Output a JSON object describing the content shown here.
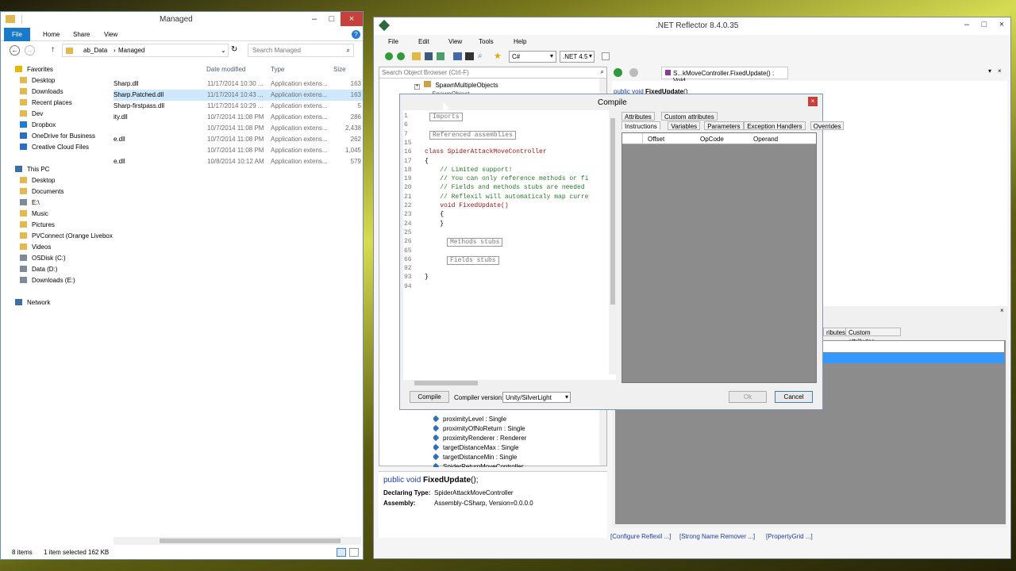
{
  "explorer": {
    "title": "Managed",
    "ribbon": [
      "File",
      "Home",
      "Share",
      "View"
    ],
    "path": [
      "ab_Data",
      "Managed"
    ],
    "search_placeholder": "Search Managed",
    "nav": [
      {
        "label": "Favorites",
        "icon": "star-icon",
        "group": true
      },
      {
        "label": "Desktop",
        "icon": "folder-icon"
      },
      {
        "label": "Downloads",
        "icon": "folder-icon"
      },
      {
        "label": "Recent places",
        "icon": "folder-icon"
      },
      {
        "label": "Dev",
        "icon": "folder-icon"
      },
      {
        "label": "Dropbox",
        "icon": "dropbox-icon"
      },
      {
        "label": "OneDrive for Business",
        "icon": "cloud-icon"
      },
      {
        "label": "Creative Cloud Files",
        "icon": "cloud-icon"
      },
      {
        "label": "",
        "spacer": true
      },
      {
        "label": "This PC",
        "icon": "computer-icon",
        "group": true
      },
      {
        "label": "Desktop",
        "icon": "folder-icon"
      },
      {
        "label": "Documents",
        "icon": "folder-icon"
      },
      {
        "label": "E:\\",
        "icon": "drive-icon"
      },
      {
        "label": "Music",
        "icon": "folder-icon"
      },
      {
        "label": "Pictures",
        "icon": "folder-icon"
      },
      {
        "label": "PVConnect (Orange Livebox",
        "icon": "folder-icon"
      },
      {
        "label": "Videos",
        "icon": "folder-icon"
      },
      {
        "label": "OSDisk (C:)",
        "icon": "drive-icon"
      },
      {
        "label": "Data (D:)",
        "icon": "drive-icon"
      },
      {
        "label": "Downloads (E:)",
        "icon": "drive-icon"
      },
      {
        "label": "",
        "spacer": true
      },
      {
        "label": "Network",
        "icon": "network-icon",
        "group": true
      }
    ],
    "columns": [
      "Date modified",
      "Type",
      "Size"
    ],
    "files": [
      {
        "name": "Sharp.dll",
        "date": "11/17/2014 10:30 ...",
        "type": "Application extens...",
        "size": "163"
      },
      {
        "name": "Sharp.Patched.dll",
        "date": "11/17/2014 10:43 ...",
        "type": "Application extens...",
        "size": "163"
      },
      {
        "name": "Sharp-firstpass.dll",
        "date": "11/17/2014 10:29 ...",
        "type": "Application extens...",
        "size": "5"
      },
      {
        "name": "ity.dll",
        "date": "10/7/2014 11:08 PM",
        "type": "Application extens...",
        "size": "286"
      },
      {
        "name": "",
        "date": "10/7/2014 11:08 PM",
        "type": "Application extens...",
        "size": "2,438"
      },
      {
        "name": "e.dll",
        "date": "10/7/2014 11:08 PM",
        "type": "Application extens...",
        "size": "262"
      },
      {
        "name": "",
        "date": "10/7/2014 11:08 PM",
        "type": "Application extens...",
        "size": "1,045"
      },
      {
        "name": "e.dll",
        "date": "10/8/2014 10:12 AM",
        "type": "Application extens...",
        "size": "579"
      }
    ],
    "status_items": "8 items",
    "status_selected": "1 item selected  162 KB"
  },
  "reflector": {
    "title": ".NET Reflector 8.4.0.35",
    "menu": [
      "File",
      "Edit",
      "View",
      "Tools",
      "Help"
    ],
    "language": "C#",
    "framework": ".NET 4.5",
    "search_placeholder": "Search Object Browser (Ctrl-F)",
    "tree_top": [
      "SpawnMultipleObjects",
      "SpawnObject"
    ],
    "tree_members": [
      "proximityLevel : Single",
      "proximityOfNoReturn : Single",
      "proximityRenderer : Renderer",
      "targetDistanceMax : Single",
      "targetDistanceMin : Single",
      "SpiderReturnMoveController"
    ],
    "doc_tab": "S...kMoveController.FixedUpdate() : Void",
    "decomp_prefix": "public void ",
    "decomp_method": "FixedUpdate",
    "decomp_suffix": "()",
    "sig_prefix": "public void ",
    "sig_method": "FixedUpdate",
    "sig_suffix": "();",
    "declaring_label": "Declaring Type:",
    "declaring_value": "SpiderAttackMoveController",
    "assembly_label": "Assembly:",
    "assembly_value": "Assembly-CSharp, Version=0.0.0.0",
    "lower_tabs": [
      "ributes",
      "Custom attributes"
    ],
    "links": [
      "[Configure Reflexil ...]",
      "[Strong Name Remover ...]",
      "[PropertyGrid ...]"
    ]
  },
  "compile": {
    "title": "Compile",
    "line_numbers": [
      "1",
      "6",
      "7",
      "15",
      "16",
      "17",
      "18",
      "19",
      "20",
      "21",
      "22",
      "23",
      "24",
      "25",
      "26",
      "65",
      "66",
      "92",
      "93",
      "94"
    ],
    "code": [
      {
        "kind": "region",
        "text": "Imports"
      },
      {
        "kind": "blank",
        "text": ""
      },
      {
        "kind": "region",
        "text": "Referenced assemblies"
      },
      {
        "kind": "blank",
        "text": ""
      },
      {
        "kind": "class",
        "text": "class SpiderAttackMoveController"
      },
      {
        "kind": "plain",
        "text": "{"
      },
      {
        "kind": "comment",
        "text": "    // Limited support!"
      },
      {
        "kind": "comment",
        "text": "    // You can only reference methods or fi"
      },
      {
        "kind": "comment",
        "text": "    // Fields and methods stubs are needed"
      },
      {
        "kind": "comment",
        "text": "    // Reflexil will automaticaly map curre"
      },
      {
        "kind": "method",
        "text": "    void FixedUpdate()"
      },
      {
        "kind": "plain",
        "text": "    {"
      },
      {
        "kind": "plain",
        "text": "    }"
      },
      {
        "kind": "blank",
        "text": ""
      },
      {
        "kind": "region",
        "text": "Methods stubs"
      },
      {
        "kind": "blank",
        "text": ""
      },
      {
        "kind": "region",
        "text": "Fields stubs"
      },
      {
        "kind": "blank",
        "text": ""
      },
      {
        "kind": "plain",
        "text": "}"
      },
      {
        "kind": "blank",
        "text": ""
      }
    ],
    "compile_button": "Compile",
    "compiler_label": "Compiler version:",
    "compiler_value": "Unity/SilverLight",
    "tabs_top": [
      "Attributes",
      "Custom attributes"
    ],
    "tabs_bottom": [
      "Instructions",
      "Variables",
      "Parameters",
      "Exception Handlers",
      "Overrides"
    ],
    "grid_columns": [
      "Offset",
      "OpCode",
      "Operand"
    ],
    "ok": "Ok",
    "cancel": "Cancel"
  }
}
